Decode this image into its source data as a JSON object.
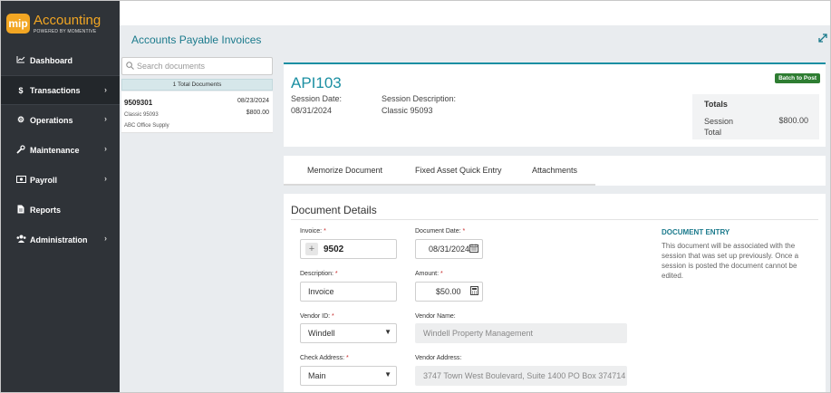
{
  "brand": {
    "logo_mark": "mip",
    "title": "Accounting",
    "subtitle": "POWERED BY MOMENTIVE",
    "accent": "#f2a623"
  },
  "sidebar": {
    "items": [
      {
        "label": "Dashboard",
        "icon": "chart-line-icon",
        "chevron": ""
      },
      {
        "label": "Transactions",
        "icon": "dollar-icon",
        "chevron": "›",
        "active": true
      },
      {
        "label": "Operations",
        "icon": "cogs-icon",
        "chevron": "›"
      },
      {
        "label": "Maintenance",
        "icon": "wrench-icon",
        "chevron": "›"
      },
      {
        "label": "Payroll",
        "icon": "money-bill-icon",
        "chevron": "›"
      },
      {
        "label": "Reports",
        "icon": "file-icon",
        "chevron": ""
      },
      {
        "label": "Administration",
        "icon": "users-icon",
        "chevron": "›"
      }
    ]
  },
  "header": {
    "title": "Accounts Payable Invoices"
  },
  "doc_list": {
    "search_placeholder": "Search documents",
    "total_label": "1 Total Documents",
    "items": [
      {
        "number": "9509301",
        "date": "08/23/2024",
        "description": "Classic 95093",
        "amount": "$800.00",
        "vendor": "ABC Office Supply"
      }
    ]
  },
  "session": {
    "id": "API103",
    "batch_button": "Batch to Post",
    "date_label": "Session Date:",
    "date_value": "08/31/2024",
    "desc_label": "Session Description:",
    "desc_value": "Classic 95093",
    "totals_title": "Totals",
    "totals_label": "Session Total",
    "totals_value": "$800.00"
  },
  "tabs": [
    "Memorize Document",
    "Fixed Asset Quick Entry",
    "Attachments"
  ],
  "details": {
    "title": "Document Details",
    "invoice_label": "Invoice:",
    "invoice_value": "9502",
    "doc_date_label": "Document Date:",
    "doc_date_value": "08/31/2024",
    "description_label": "Description:",
    "description_value": "Invoice",
    "amount_label": "Amount:",
    "amount_value": "$50.00",
    "vendor_id_label": "Vendor ID:",
    "vendor_id_value": "Windell",
    "vendor_name_label": "Vendor Name:",
    "vendor_name_value": "Windell Property Management",
    "check_address_label": "Check Address:",
    "check_address_value": "Main",
    "vendor_address_label": "Vendor Address:",
    "vendor_address_value": "3747 Town West Boulevard, Suite 1400 PO Box 374714",
    "required_mark": "*"
  },
  "entry_info": {
    "title": "DOCUMENT ENTRY",
    "text": "This document will be associated with the session that was set up previously. Once a session is posted the document cannot be edited."
  }
}
